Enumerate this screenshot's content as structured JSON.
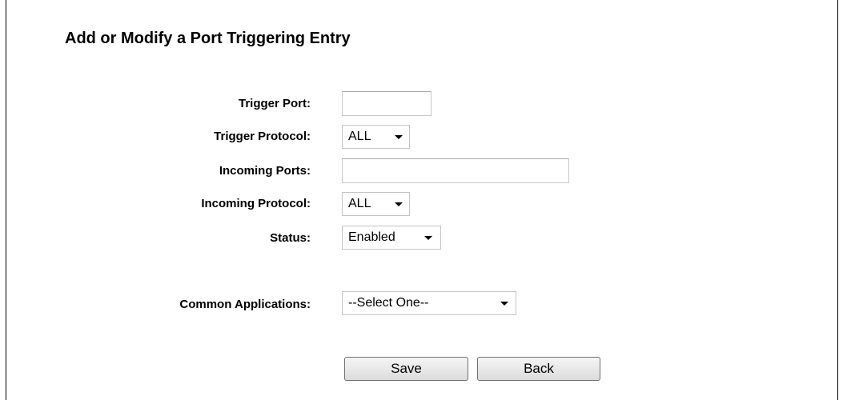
{
  "page_title": "Add or Modify a Port Triggering Entry",
  "form": {
    "trigger_port": {
      "label": "Trigger Port:",
      "value": ""
    },
    "trigger_protocol": {
      "label": "Trigger Protocol:",
      "value": "ALL"
    },
    "incoming_ports": {
      "label": "Incoming Ports:",
      "value": ""
    },
    "incoming_protocol": {
      "label": "Incoming Protocol:",
      "value": "ALL"
    },
    "status": {
      "label": "Status:",
      "value": "Enabled"
    },
    "common_applications": {
      "label": "Common Applications:",
      "value": "--Select One--"
    }
  },
  "buttons": {
    "save": "Save",
    "back": "Back"
  }
}
